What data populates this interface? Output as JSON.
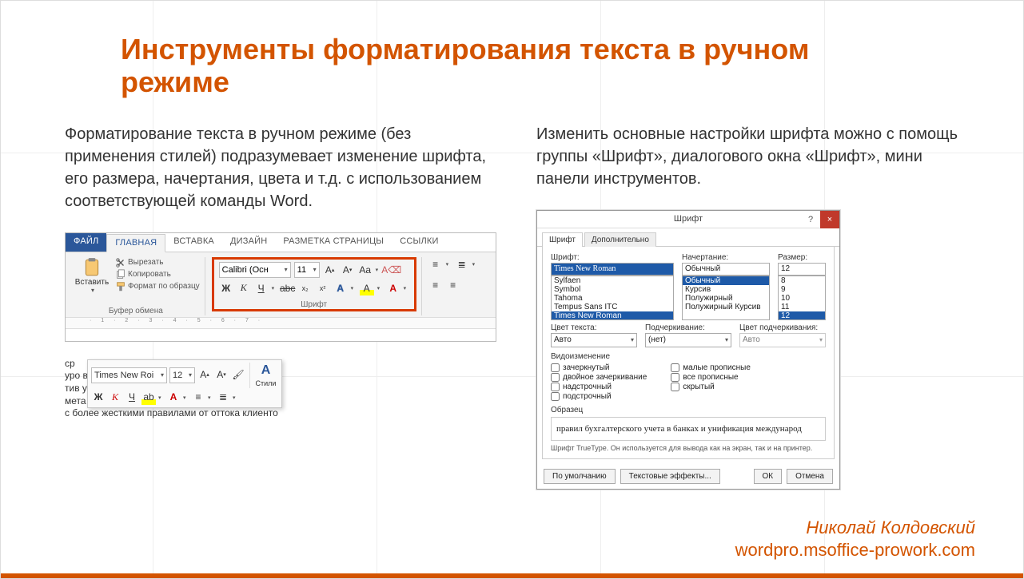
{
  "slide": {
    "title": "Инструменты форматирования текста в ручном режиме",
    "left_paragraph": "Форматирование текста в ручном режиме (без применения стилей) подразумевает изменение шрифта, его размера, начертания, цвета и т.д. с использованием соответствующей команды Word.",
    "right_paragraph": "Изменить основные настройки шрифта можно с помощь группы «Шрифт», диалогового окна «Шрифт», мини панели инструментов."
  },
  "ribbon": {
    "tabs": {
      "file": "ФАЙЛ",
      "home": "ГЛАВНАЯ",
      "insert": "ВСТАВКА",
      "design": "ДИЗАЙН",
      "layout": "РАЗМЕТКА СТРАНИЦЫ",
      "references": "ССЫЛКИ"
    },
    "clipboard": {
      "paste": "Вставить",
      "cut": "Вырезать",
      "copy": "Копировать",
      "format_painter": "Формат по образцу",
      "group_label": "Буфер обмена"
    },
    "font_group": {
      "font_name": "Calibri (Осн",
      "font_size": "11",
      "bold": "Ж",
      "italic": "К",
      "underline": "Ч",
      "strike": "abc",
      "sub": "x₂",
      "sup": "x²",
      "text_effects": "A",
      "highlight": "A",
      "font_color": "A",
      "grow": "A",
      "shrink": "A",
      "case": "Aa",
      "clear": "✎",
      "group_label": "Шрифт"
    }
  },
  "mini_toolbar": {
    "font_name": "Times New Roi",
    "font_size": "12",
    "bold": "Ж",
    "italic": "К",
    "underline": "Ч",
    "styles_A": "A",
    "styles_label": "Стили",
    "back_lines": [
      " ср",
      " уро                                                           вов",
      "тив                                                           унис",
      "мета                                                          пра",
      "с более жесткими правилами от оттока клиенто"
    ]
  },
  "font_dialog": {
    "title": "Шрифт",
    "help_glyph": "?",
    "close_glyph": "×",
    "tab_font": "Шрифт",
    "tab_advanced": "Дополнительно",
    "labels": {
      "font": "Шрифт:",
      "style": "Начертание:",
      "size": "Размер:",
      "font_color": "Цвет текста:",
      "underline_style": "Подчеркивание:",
      "underline_color": "Цвет подчеркивания:",
      "effects": "Видоизменение",
      "preview": "Образец"
    },
    "font_value": "Times New Roman",
    "font_list": [
      "Sylfaen",
      "Symbol",
      "Tahoma",
      "Tempus Sans ITC",
      "Times New Roman"
    ],
    "style_value": "Обычный",
    "style_list": [
      "Обычный",
      "Курсив",
      "Полужирный",
      "Полужирный Курсив"
    ],
    "size_value": "12",
    "size_list": [
      "8",
      "9",
      "10",
      "11",
      "12"
    ],
    "font_color_value": "Авто",
    "underline_style_value": "(нет)",
    "underline_color_value": "Авто",
    "effects_left": [
      "зачеркнутый",
      "двойное зачеркивание",
      "надстрочный",
      "подстрочный"
    ],
    "effects_right": [
      "малые прописные",
      "все прописные",
      "скрытый"
    ],
    "preview_text": "правил бухгалтерского учета в банках и унификация международ",
    "hint": "Шрифт TrueType. Он используется для вывода как на экран, так и на принтер.",
    "buttons": {
      "default": "По умолчанию",
      "text_effects": "Текстовые эффекты...",
      "ok": "ОК",
      "cancel": "Отмена"
    }
  },
  "footer": {
    "author": "Николай Колдовский",
    "url": "wordpro.msoffice-prowork.com"
  }
}
